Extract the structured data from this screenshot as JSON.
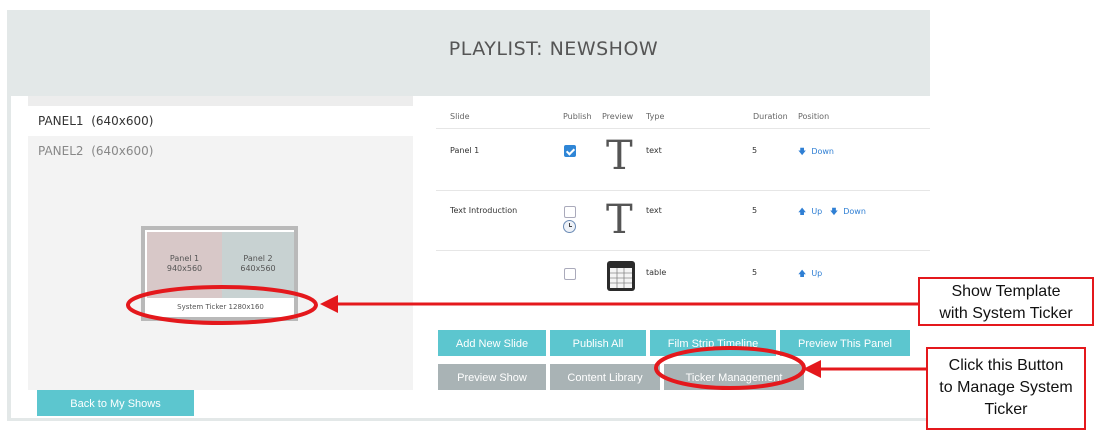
{
  "header": {
    "title": "PLAYLIST: NEWSHOW"
  },
  "panels": [
    {
      "name": "PANEL1",
      "size": "(640x600)"
    },
    {
      "name": "PANEL2",
      "size": "(640x600)"
    }
  ],
  "template": {
    "panel1_label": "Panel 1",
    "panel1_size": "940x560",
    "panel2_label": "Panel 2",
    "panel2_size": "640x560",
    "ticker_label": "System Ticker 1280x160"
  },
  "back_button": "Back to My Shows",
  "table": {
    "headers": [
      "Slide",
      "Publish",
      "Preview",
      "Type",
      "Duration",
      "Position"
    ],
    "rows": [
      {
        "slide": "Panel 1",
        "published": true,
        "preview": "T",
        "type": "text",
        "duration": "5",
        "up": "",
        "down": "Down"
      },
      {
        "slide": "Text Introduction",
        "published": false,
        "preview": "T",
        "type": "text",
        "duration": "5",
        "up": "Up",
        "down": "Down"
      },
      {
        "slide": "",
        "published": false,
        "preview": "table-icon",
        "type": "table",
        "duration": "5",
        "up": "Up",
        "down": ""
      }
    ]
  },
  "buttons": {
    "add_new_slide": "Add New Slide",
    "publish_all": "Publish All",
    "film_strip_timeline": "Film Strip Timeline",
    "preview_this_panel": "Preview This Panel",
    "preview_show": "Preview Show",
    "content_library": "Content Library",
    "ticker_management": "Ticker Management"
  },
  "annotations": {
    "callout_template_line1": "Show Template",
    "callout_template_line2": "with System Ticker",
    "callout_button_line1": "Click this Button",
    "callout_button_line2": "to Manage System",
    "callout_button_line3": "Ticker"
  },
  "colors": {
    "accent_teal": "#5cc6cf",
    "button_grey": "#a9b3b5",
    "annotation_red": "#e4181c",
    "link_blue": "#2f7fd4"
  }
}
